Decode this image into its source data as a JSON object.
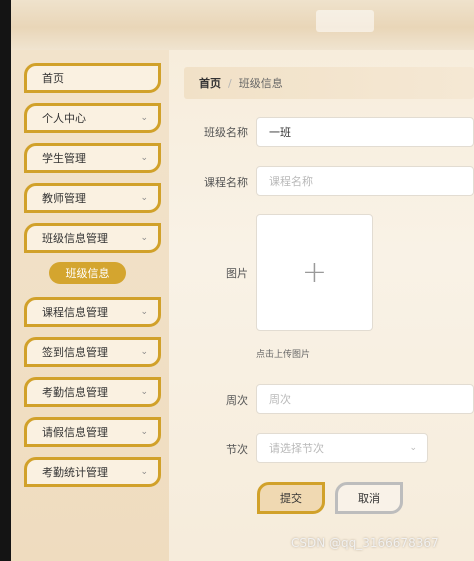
{
  "sidebar": {
    "items": [
      {
        "label": "首页",
        "has_chevron": false
      },
      {
        "label": "个人中心",
        "has_chevron": true
      },
      {
        "label": "学生管理",
        "has_chevron": true
      },
      {
        "label": "教师管理",
        "has_chevron": true
      },
      {
        "label": "班级信息管理",
        "has_chevron": true
      },
      {
        "label": "课程信息管理",
        "has_chevron": true
      },
      {
        "label": "签到信息管理",
        "has_chevron": true
      },
      {
        "label": "考勤信息管理",
        "has_chevron": true
      },
      {
        "label": "请假信息管理",
        "has_chevron": true
      },
      {
        "label": "考勤统计管理",
        "has_chevron": true
      }
    ],
    "active_sub_item": "班级信息",
    "chevron_icon": "chevron-down-icon"
  },
  "breadcrumb": {
    "home": "首页",
    "separator": "/",
    "current": "班级信息"
  },
  "form": {
    "class_name": {
      "label": "班级名称",
      "value": "一班"
    },
    "course_name": {
      "label": "课程名称",
      "placeholder": "课程名称"
    },
    "image": {
      "label": "图片",
      "tip": "点击上传图片",
      "icon": "plus-icon"
    },
    "week": {
      "label": "周次",
      "placeholder": "周次"
    },
    "period": {
      "label": "节次",
      "placeholder": "请选择节次"
    },
    "submit_label": "提交",
    "cancel_label": "取消"
  },
  "watermark": "CSDN @qq_3166678367",
  "colors": {
    "accent": "#d1a12a",
    "active_sub_bg": "#d4a52f",
    "sidebar_bg": "#f2e3cb",
    "content_bg": "#f7eddc"
  }
}
